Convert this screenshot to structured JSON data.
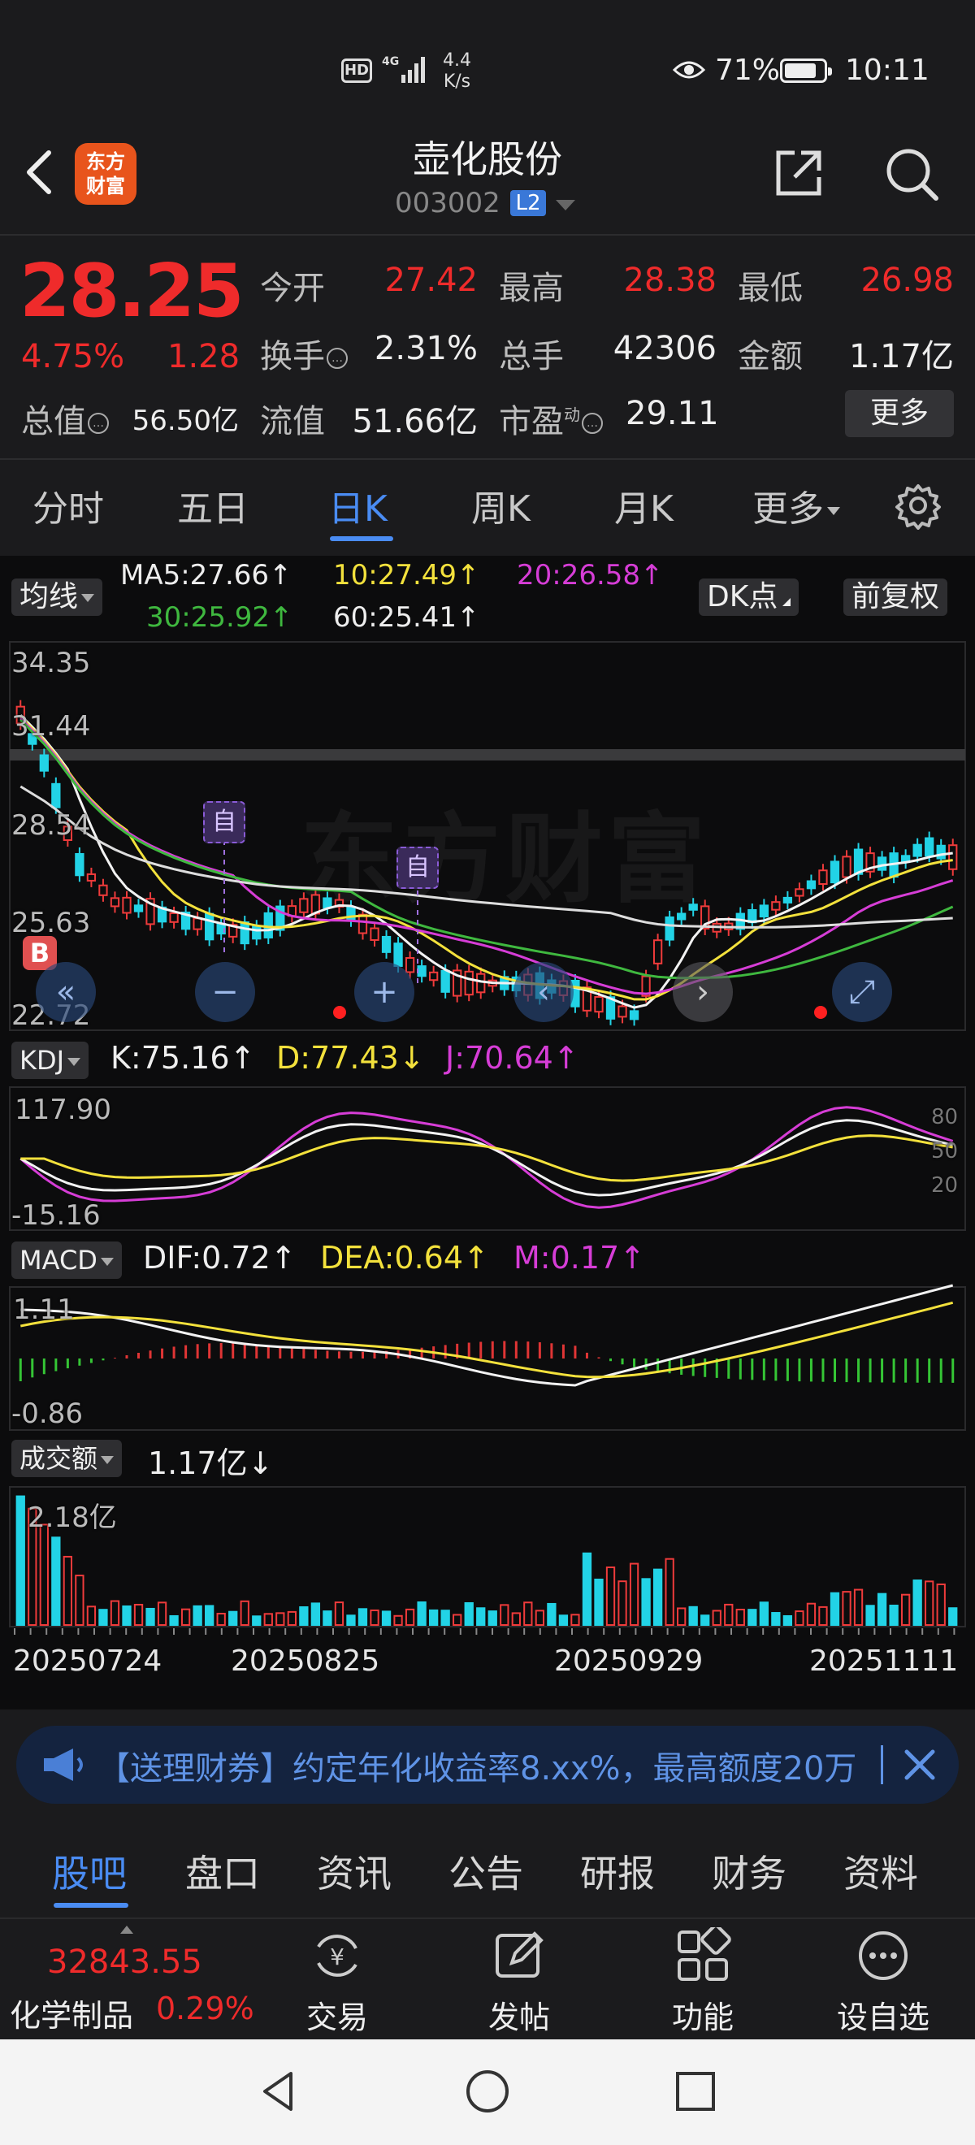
{
  "status_bar": {
    "hd": "HD",
    "net": "4G",
    "speed_val": "4.4",
    "speed_unit": "K/s",
    "battery": "71%",
    "time": "10:11"
  },
  "header": {
    "title": "壶化股份",
    "code": "003002",
    "level": "L2",
    "logo_line1": "东方",
    "logo_line2": "财富"
  },
  "quote": {
    "price": "28.25",
    "change_pct": "4.75%",
    "change": "1.28",
    "open_label": "今开",
    "open": "27.42",
    "high_label": "最高",
    "high": "28.38",
    "low_label": "最低",
    "low": "26.98",
    "turnover_label": "换手",
    "turnover": "2.31%",
    "volume_label": "总手",
    "volume": "42306",
    "amount_label": "金额",
    "amount": "1.17亿",
    "mktcap_label": "总值",
    "mktcap": "56.50亿",
    "float_label": "流值",
    "float": "51.66亿",
    "pe_label": "市盈",
    "pe_sup": "动",
    "pe": "29.11",
    "more": "更多"
  },
  "tabs": [
    "分时",
    "五日",
    "日K",
    "周K",
    "月K",
    "更多"
  ],
  "ma_bar": {
    "chip": "均线",
    "ma5": "MA5:27.66↑",
    "ma10": "10:27.49↑",
    "ma20": "20:26.58↑",
    "ma30": "30:25.92↑",
    "ma60": "60:25.41↑",
    "dk": "DK点",
    "fq": "前复权"
  },
  "price_axis": [
    "34.35",
    "31.44",
    "28.54",
    "25.63",
    "22.72"
  ],
  "markers": {
    "zi": "自",
    "b": "B"
  },
  "watermark": "东方财富",
  "kdj": {
    "chip": "KDJ",
    "k": "K:75.16↑",
    "d": "D:77.43↓",
    "j": "J:70.64↑",
    "top": "117.90",
    "bottom": "-15.16",
    "l80": "80",
    "l50": "50",
    "l20": "20"
  },
  "macd": {
    "chip": "MACD",
    "dif": "DIF:0.72↑",
    "dea": "DEA:0.64↑",
    "m": "M:0.17↑",
    "top": "1.11",
    "bottom": "-0.86"
  },
  "vol": {
    "chip": "成交额",
    "val": "1.17亿↓",
    "top": "2.18亿"
  },
  "dates": [
    "20250724",
    "20250825",
    "20250929",
    "20251111"
  ],
  "banner": {
    "text": "【送理财券】约定年化收益率8.xx%，最高额度20万"
  },
  "subtabs": [
    "股吧",
    "盘口",
    "资讯",
    "公告",
    "研报",
    "财务",
    "资料"
  ],
  "bottom": {
    "index_val": "32843.55",
    "index_name": "化学制品",
    "index_pct": "0.29%",
    "items": [
      "交易",
      "发帖",
      "功能",
      "设自选"
    ]
  }
}
